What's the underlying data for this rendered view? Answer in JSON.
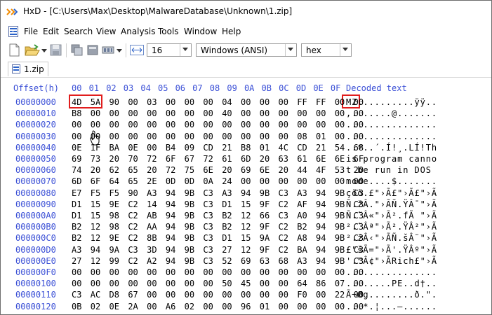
{
  "window": {
    "title": "HxD - [C:\\Users\\Max\\Desktop\\MalwareDatabase\\Unknown\\1.zip]"
  },
  "menu": [
    "File",
    "Edit",
    "Search",
    "View",
    "Analysis",
    "Tools",
    "Window",
    "Help"
  ],
  "toolbar": {
    "bytes_per_row": "16",
    "charset": "Windows (ANSI)",
    "offset_base": "hex"
  },
  "tab": {
    "label": "1.zip"
  },
  "editor": {
    "offset_header": "Offset(h)",
    "column_headers": [
      "00",
      "01",
      "02",
      "03",
      "04",
      "05",
      "06",
      "07",
      "08",
      "09",
      "0A",
      "0B",
      "0C",
      "0D",
      "0E",
      "0F"
    ],
    "decoded_header": "Decoded text",
    "rows": [
      {
        "offset": "00000000",
        "bytes": "4D 5A 90 00 03 00 00 00 04 00 00 00 FF FF 00 00",
        "text": "MZ..........ÿÿ.."
      },
      {
        "offset": "00000010",
        "bytes": "B8 00 00 00 00 00 00 00 40 00 00 00 00 00 00 00",
        "text": ",.......@......."
      },
      {
        "offset": "00000020",
        "bytes": "00 00 00 00 00 00 00 00 00 00 00 00 00 00 00 00",
        "text": "................"
      },
      {
        "offset": "00000030",
        "bytes": "00 00 00 00 00 00 00 00 00 00 00 00 08 01 00 00",
        "text": "................"
      },
      {
        "offset": "00000040",
        "bytes": "0E 1F BA 0E 00 B4 09 CD 21 B8 01 4C CD 21 54 68",
        "text": "..º..´.Í!¸.LÍ!Th"
      },
      {
        "offset": "00000050",
        "bytes": "69 73 20 70 72 6F 67 72 61 6D 20 63 61 6E 6E 6F",
        "text": "is program canno"
      },
      {
        "offset": "00000060",
        "bytes": "74 20 62 65 20 72 75 6E 20 69 6E 20 44 4F 53 20",
        "text": "t be run in DOS "
      },
      {
        "offset": "00000070",
        "bytes": "6D 6F 64 65 2E 0D 0D 0A 24 00 00 00 00 00 00 00",
        "text": "mode....$......."
      },
      {
        "offset": "00000080",
        "bytes": "E7 F5 F5 90 A3 94 9B C3 A3 94 9B C3 A3 94 9B C3",
        "text": "çõõ.£\"›Ã£\"›Ã£\"›Ã"
      },
      {
        "offset": "00000090",
        "bytes": "D1 15 9E C2 14 94 9B C3 D1 15 9F C2 AF 94 9B C3",
        "text": "Ñ.žÂ.\"›ÃÑ.ŸÂ¯\"›Ã"
      },
      {
        "offset": "000000A0",
        "bytes": "D1 15 98 C2 AB 94 9B C3 B2 12 66 C3 A0 94 9B C3",
        "text": "Ñ.˜Â«\"›Ã².fÃ \"›Ã"
      },
      {
        "offset": "000000B0",
        "bytes": "B2 12 98 C2 AA 94 9B C3 B2 12 9F C2 B2 94 9B C3",
        "text": "².˜Âª\"›Ã².ŸÂ²\"›Ã"
      },
      {
        "offset": "000000C0",
        "bytes": "B2 12 9E C2 8B 94 9B C3 D1 15 9A C2 A8 94 9B C3",
        "text": "².žÂ‹\"›ÃÑ.šÂ¨\"›Ã"
      },
      {
        "offset": "000000D0",
        "bytes": "A3 94 9A C3 3D 94 9B C3 27 12 9F C2 BA 94 9B C3",
        "text": "£\"šÃ=\"›Ã'.ŸÂº\"›Ã"
      },
      {
        "offset": "000000E0",
        "bytes": "27 12 99 C2 A2 94 9B C3 52 69 63 68 A3 94 9B C3",
        "text": "'.™Â¢\"›ÃRich£\"›Ã"
      },
      {
        "offset": "000000F0",
        "bytes": "00 00 00 00 00 00 00 00 00 00 00 00 00 00 00 00",
        "text": "................"
      },
      {
        "offset": "00000100",
        "bytes": "00 00 00 00 00 00 00 00 50 45 00 00 64 86 07 00",
        "text": "........PE..d†.."
      },
      {
        "offset": "00000110",
        "bytes": "C3 AC D8 67 00 00 00 00 00 00 00 00 F0 00 22 00",
        "text": "Ã¬Øg........ð.\"."
      },
      {
        "offset": "00000120",
        "bytes": "0B 02 0E 2A 00 A6 02 00 00 96 01 00 00 00 00 00",
        "text": "...*.¦...–......"
      }
    ]
  }
}
